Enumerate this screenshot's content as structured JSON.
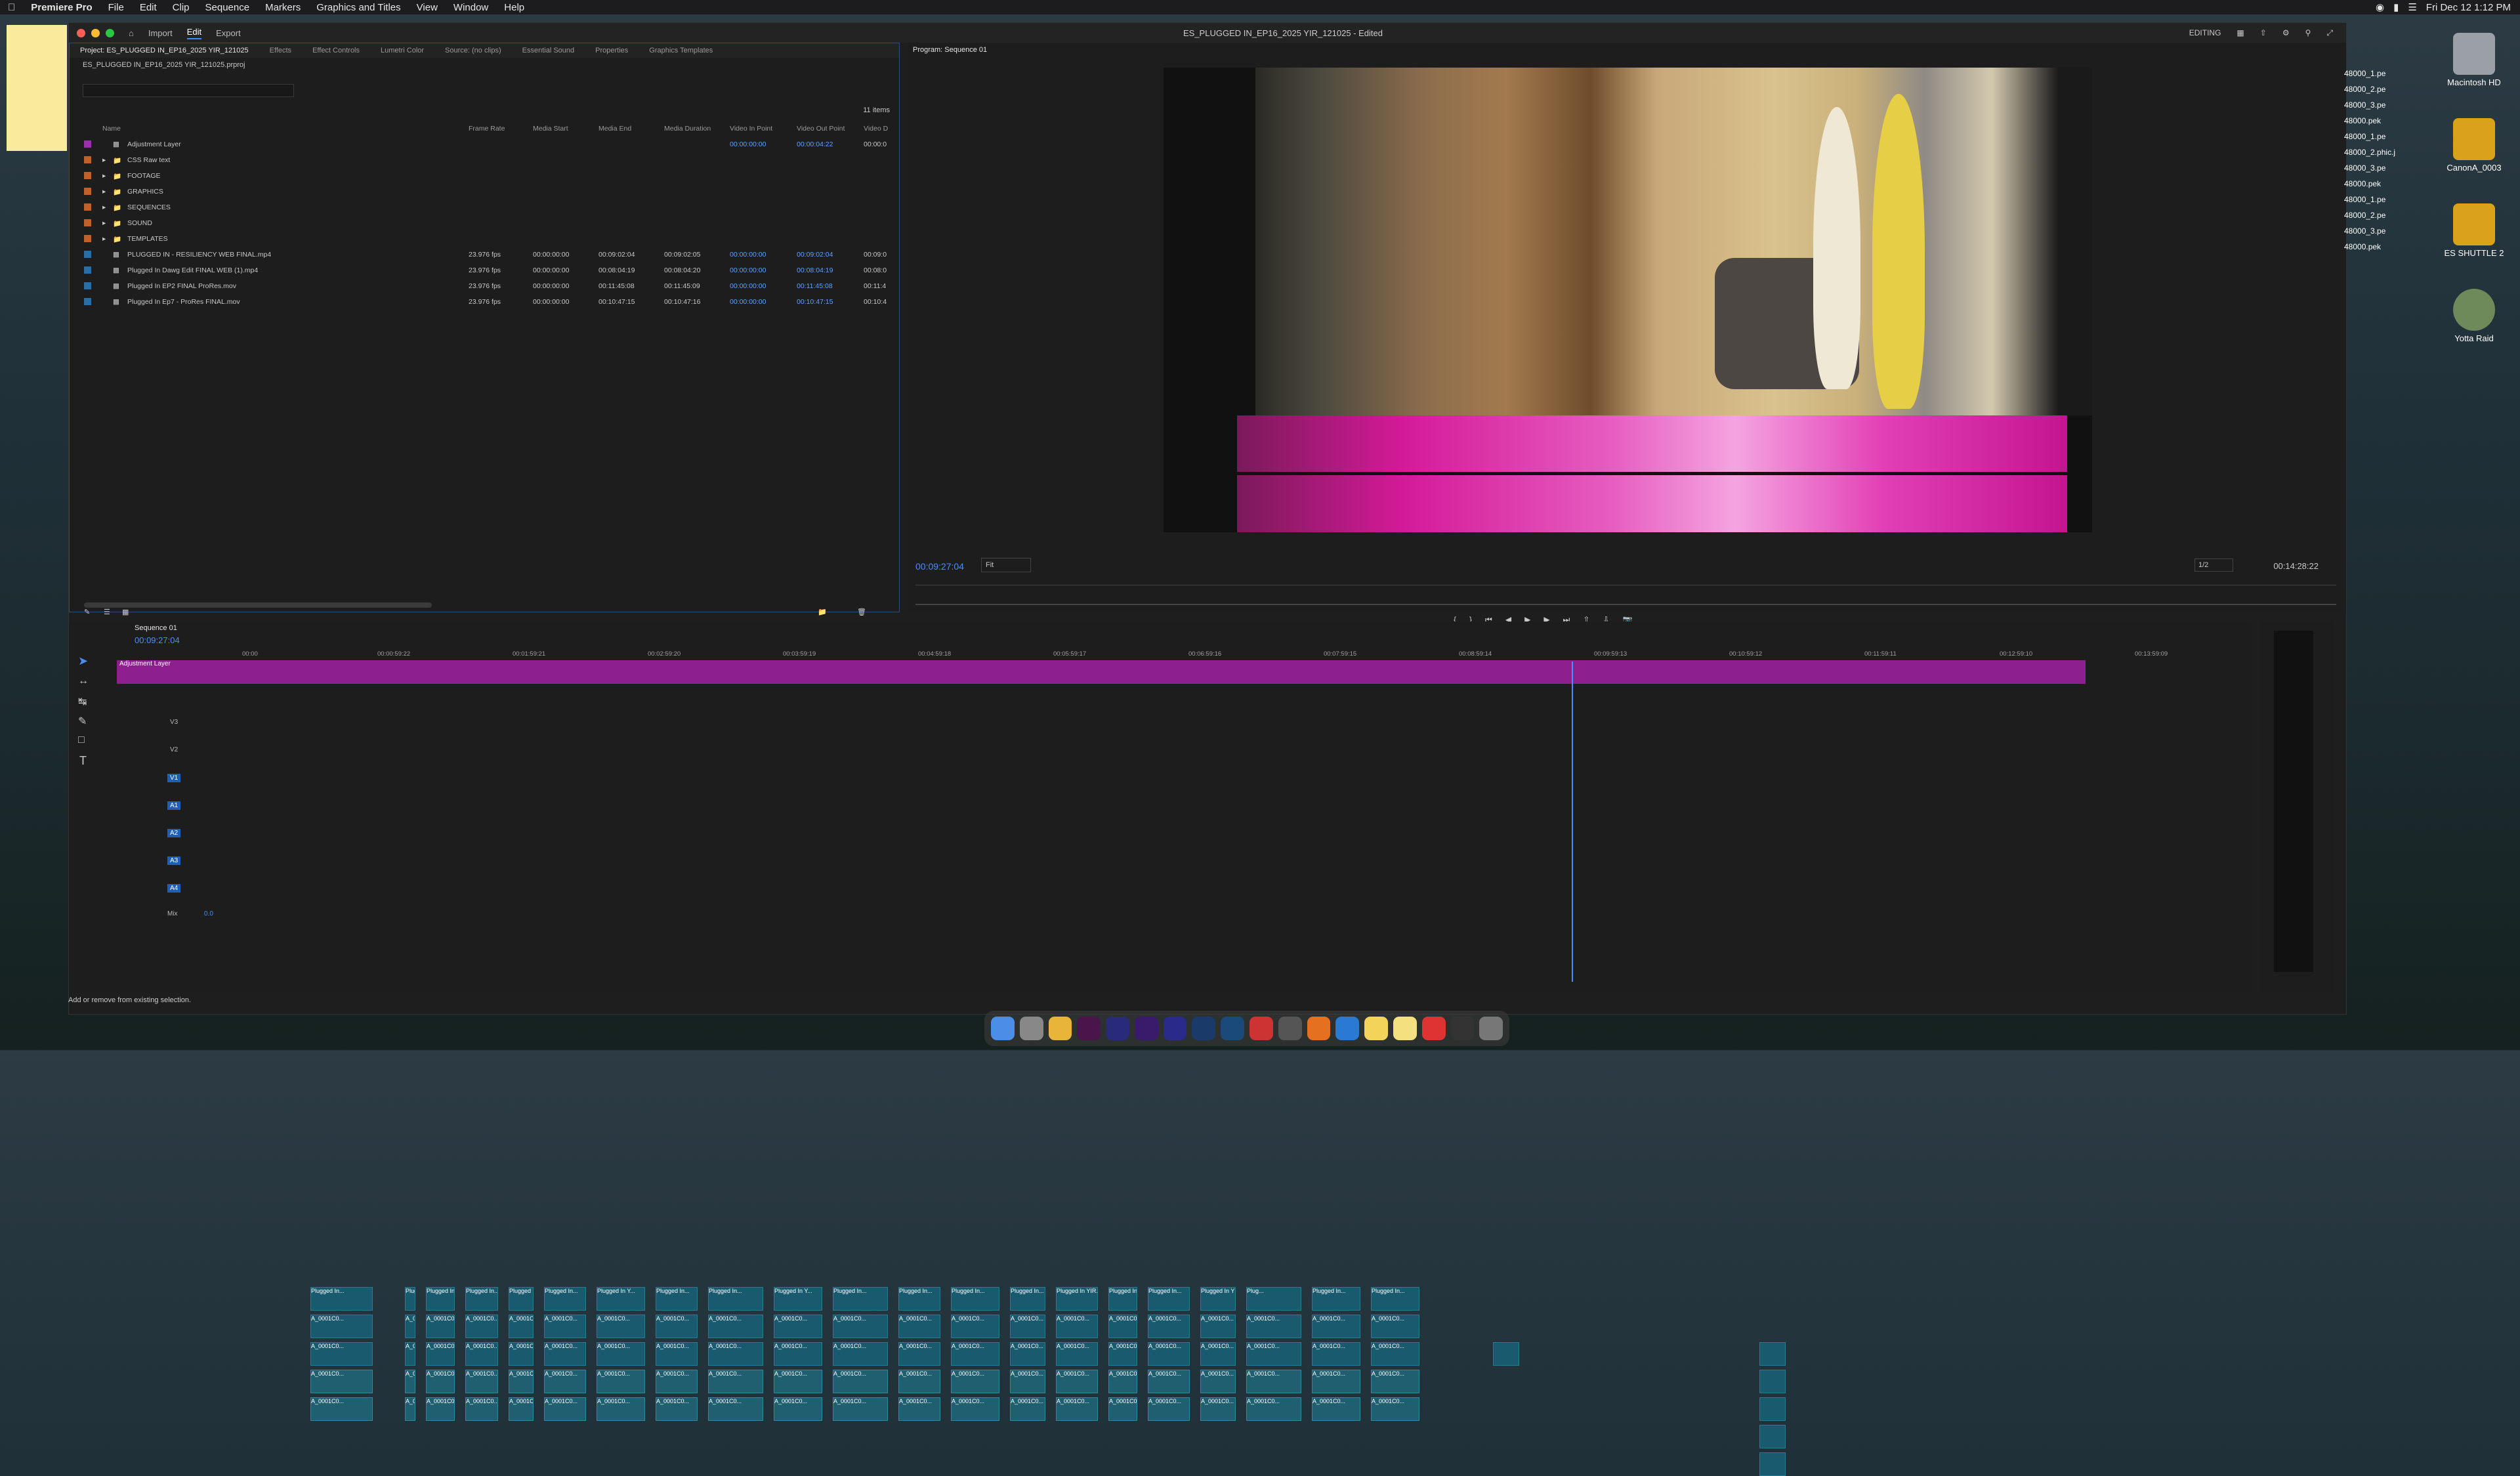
{
  "menubar": {
    "app": "Premiere Pro",
    "items": [
      "File",
      "Edit",
      "Clip",
      "Sequence",
      "Markers",
      "Graphics and Titles",
      "View",
      "Window",
      "Help"
    ],
    "clock": "Fri Dec 12  1:12 PM"
  },
  "window": {
    "title": "ES_PLUGGED IN_EP16_2025 YIR_121025 - Edited",
    "tabs": [
      "Import",
      "Edit",
      "Export"
    ],
    "active_tab": "Edit",
    "workspace": "EDITING"
  },
  "project": {
    "tabs": [
      "Project: ES_PLUGGED IN_EP16_2025 YIR_121025",
      "Effects",
      "Effect Controls",
      "Lumetri Color",
      "Source: (no clips)",
      "Essential Sound",
      "Properties",
      "Graphics Templates"
    ],
    "path": "ES_PLUGGED IN_EP16_2025 YIR_121025.prproj",
    "count": "11 items",
    "columns": [
      "Name",
      "Frame Rate",
      "Media Start",
      "Media End",
      "Media Duration",
      "Video In Point",
      "Video Out Point",
      "Video D"
    ],
    "rows": [
      {
        "name": "Adjustment Layer",
        "fr": "",
        "ms": "",
        "me": "",
        "md": "",
        "vin": "00:00:00:00",
        "vout": "00:00:04:22",
        "vd": "00:00:0",
        "color": "#9b2fae",
        "folder": false
      },
      {
        "name": "CSS Raw text",
        "fr": "",
        "ms": "",
        "me": "",
        "md": "",
        "vin": "",
        "vout": "",
        "vd": "",
        "color": "#c0602a",
        "folder": true
      },
      {
        "name": "FOOTAGE",
        "fr": "",
        "ms": "",
        "me": "",
        "md": "",
        "vin": "",
        "vout": "",
        "vd": "",
        "color": "#c0602a",
        "folder": true
      },
      {
        "name": "GRAPHICS",
        "fr": "",
        "ms": "",
        "me": "",
        "md": "",
        "vin": "",
        "vout": "",
        "vd": "",
        "color": "#c0602a",
        "folder": true
      },
      {
        "name": "SEQUENCES",
        "fr": "",
        "ms": "",
        "me": "",
        "md": "",
        "vin": "",
        "vout": "",
        "vd": "",
        "color": "#c0602a",
        "folder": true
      },
      {
        "name": "SOUND",
        "fr": "",
        "ms": "",
        "me": "",
        "md": "",
        "vin": "",
        "vout": "",
        "vd": "",
        "color": "#c0602a",
        "folder": true
      },
      {
        "name": "TEMPLATES",
        "fr": "",
        "ms": "",
        "me": "",
        "md": "",
        "vin": "",
        "vout": "",
        "vd": "",
        "color": "#c0602a",
        "folder": true
      },
      {
        "name": "PLUGGED IN - RESILIENCY WEB FINAL.mp4",
        "fr": "23.976 fps",
        "ms": "00:00:00:00",
        "me": "00:09:02:04",
        "md": "00:09:02:05",
        "vin": "00:00:00:00",
        "vout": "00:09:02:04",
        "vd": "00:09:0",
        "color": "#2a6ea8",
        "folder": false
      },
      {
        "name": "Plugged In Dawg Edit FINAL WEB (1).mp4",
        "fr": "23.976 fps",
        "ms": "00:00:00:00",
        "me": "00:08:04:19",
        "md": "00:08:04:20",
        "vin": "00:00:00:00",
        "vout": "00:08:04:19",
        "vd": "00:08:0",
        "color": "#2a6ea8",
        "folder": false
      },
      {
        "name": "Plugged In EP2 FINAL ProRes.mov",
        "fr": "23.976 fps",
        "ms": "00:00:00:00",
        "me": "00:11:45:08",
        "md": "00:11:45:09",
        "vin": "00:00:00:00",
        "vout": "00:11:45:08",
        "vd": "00:11:4",
        "color": "#2a6ea8",
        "folder": false
      },
      {
        "name": "Plugged In Ep7 - ProRes FINAL.mov",
        "fr": "23.976 fps",
        "ms": "00:00:00:00",
        "me": "00:10:47:15",
        "md": "00:10:47:16",
        "vin": "00:00:00:00",
        "vout": "00:10:47:15",
        "vd": "00:10:4",
        "color": "#2a6ea8",
        "folder": false
      }
    ]
  },
  "program": {
    "tab": "Program: Sequence 01",
    "timecode": "00:09:27:04",
    "zoom": "Fit",
    "resolution": "1/2",
    "duration": "00:14:28:22"
  },
  "timeline": {
    "tab": "Sequence 01",
    "timecode": "00:09:27:04",
    "ruler": [
      "00:00",
      "00:00:59:22",
      "00:01:59:21",
      "00:02:59:20",
      "00:03:59:19",
      "00:04:59:18",
      "00:05:59:17",
      "00:06:59:16",
      "00:07:59:15",
      "00:08:59:14",
      "00:09:59:13",
      "00:10:59:12",
      "00:11:59:11",
      "00:12:59:10",
      "00:13:59:09"
    ],
    "video_tracks": [
      "V3",
      "V2",
      "V1"
    ],
    "audio_tracks": [
      "A1",
      "A2",
      "A3",
      "A4"
    ],
    "mix_label": "Mix",
    "mix_value": "0.0",
    "adjustment_label": "Adjustment Layer",
    "clip_labels": [
      "Plugged In...",
      "A_0001C0...",
      "Plugged In Y...",
      "A_0002C0...",
      "Plugged In YIR...",
      "Plug...",
      "Plugged In..."
    ]
  },
  "status": "Add or remove from existing selection.",
  "desktop": {
    "icons": [
      "Macintosh HD",
      "CanonA_0003",
      "ES SHUTTLE 2",
      "Yotta Raid"
    ],
    "files": [
      "48000_1.pe",
      "48000_2.pe",
      "48000_3.pe",
      "48000.pek",
      "48000_1.pe",
      "48000_2.phic.j",
      "48000_3.pe",
      "48000.pek",
      "48000_1.pe",
      "48000_2.pe",
      "48000_3.pe",
      "48000.pek"
    ]
  },
  "colors": {
    "accent": "#4a8dff",
    "adjustment": "#8e1f8e",
    "clip": "#1a5a6e",
    "glitch": "#d41a98"
  }
}
